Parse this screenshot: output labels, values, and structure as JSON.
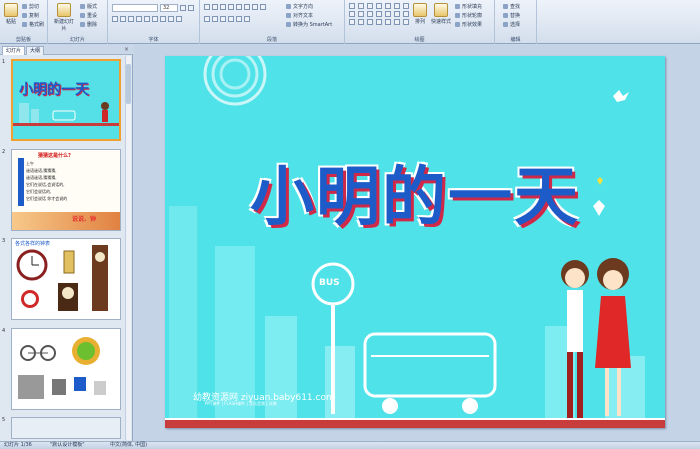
{
  "ribbon": {
    "clipboard": {
      "label": "剪贴板",
      "paste": "粘贴",
      "cut": "剪切",
      "copy": "复制",
      "painter": "格式刷"
    },
    "slides": {
      "label": "幻灯片",
      "new_slide": "新建幻灯片",
      "layout": "版式",
      "reset": "重设",
      "delete": "删除"
    },
    "font": {
      "label": "字体",
      "font_name": "",
      "font_size": "32"
    },
    "paragraph": {
      "label": "段落",
      "text_direction": "文字方向",
      "align_text": "对齐文本",
      "smartart": "转换为 SmartArt"
    },
    "drawing": {
      "label": "绘图",
      "arrange": "排列",
      "quick_styles": "快速样式",
      "fill": "形状填充",
      "outline": "形状轮廓",
      "effects": "形状效果"
    },
    "editing": {
      "label": "编辑",
      "find": "查找",
      "replace": "替换",
      "select": "选择"
    }
  },
  "panel": {
    "tab_slides": "幻灯片",
    "tab_outline": "大纲",
    "close": "×",
    "thumbs": [
      {
        "num": "1",
        "title": "小明的一天"
      },
      {
        "num": "2",
        "title": "猜猜这是什么?",
        "lines": [
          "上午",
          "谜语谜语,猜猜猜,",
          "谜语谜语,猜猜猜,",
          "它们在说话,会说话的,",
          "它们会说话的,",
          "它们会说话 你才会说的"
        ],
        "badge": "说说、钟"
      },
      {
        "num": "3",
        "title": "各式各样的钟表"
      },
      {
        "num": "4"
      },
      {
        "num": "5"
      }
    ]
  },
  "slide": {
    "title": "小明的一天",
    "bus_sign": "BUS",
    "watermark": "幼教资源网 ziyuan.baby611.com",
    "watermark_sub": "PPT课件 | FLASH课件 | 音乐音频 | 试卷"
  },
  "statusbar": {
    "slide_info": "幻灯片 1/36",
    "theme": "\"默认设计模板\"",
    "language": "中文(简体, 中国)"
  },
  "colors": {
    "slide_bg": "#4fe2e8",
    "title": "#1d5cc8",
    "title_shadow": "#d02848",
    "selected": "#f0a030"
  }
}
